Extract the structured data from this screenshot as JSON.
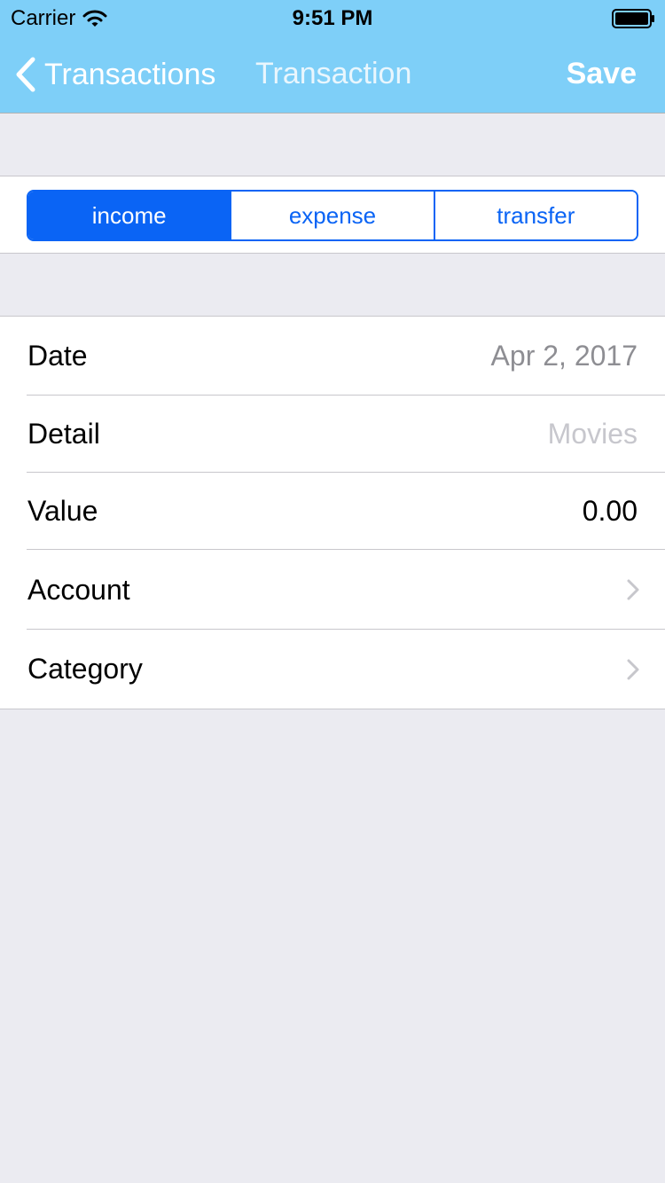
{
  "status_bar": {
    "carrier": "Carrier",
    "time": "9:51 PM",
    "icons": [
      "wifi-icon",
      "battery-icon"
    ]
  },
  "nav": {
    "back_label": "Transactions",
    "title": "Transaction",
    "save_label": "Save",
    "background_color": "#7ecff8"
  },
  "segments": {
    "items": [
      "income",
      "expense",
      "transfer"
    ],
    "selected": "income",
    "accent_color": "#0a64f5"
  },
  "form": {
    "date": {
      "label": "Date",
      "value": "Apr 2, 2017"
    },
    "detail": {
      "label": "Detail",
      "placeholder": "Movies"
    },
    "value": {
      "label": "Value",
      "value": "0.00"
    },
    "account": {
      "label": "Account",
      "icon": "chevron-right-icon"
    },
    "category": {
      "label": "Category",
      "icon": "chevron-right-icon"
    }
  }
}
